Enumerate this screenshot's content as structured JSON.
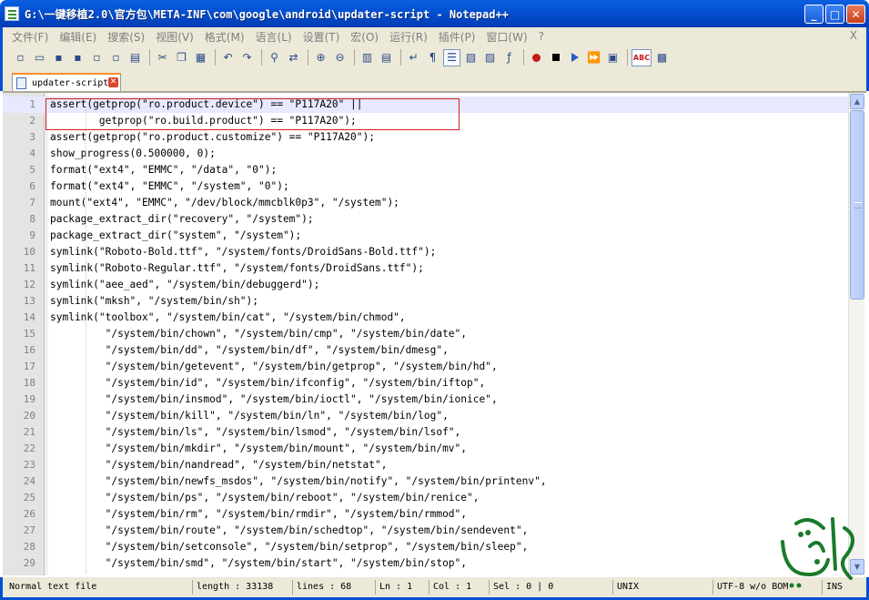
{
  "window": {
    "title": "G:\\一键移植2.0\\官方包\\META-INF\\com\\google\\android\\updater-script - Notepad++",
    "minimize_label": "_",
    "maximize_label": "□",
    "close_label": "✕"
  },
  "menu": {
    "items": [
      "文件(F)",
      "编辑(E)",
      "搜索(S)",
      "视图(V)",
      "格式(M)",
      "语言(L)",
      "设置(T)",
      "宏(O)",
      "运行(R)",
      "插件(P)",
      "窗口(W)",
      "?"
    ],
    "close_label": "X"
  },
  "toolbar": {
    "icons": [
      "new-file-icon",
      "open-file-icon",
      "save-icon",
      "save-all-icon",
      "close-icon",
      "close-all-icon",
      "print-icon",
      "cut-icon",
      "copy-icon",
      "paste-icon",
      "undo-icon",
      "redo-icon",
      "find-icon",
      "replace-icon",
      "zoom-in-icon",
      "zoom-out-icon",
      "sync-vertical-icon",
      "sync-horizontal-icon",
      "word-wrap-icon",
      "show-all-chars-icon",
      "indent-guide-icon",
      "user-define-icon",
      "doc-map-icon",
      "function-list-icon",
      "record-macro-icon",
      "stop-record-icon",
      "play-macro-icon",
      "run-macro-multiple-icon",
      "save-macro-icon",
      "spell-check-icon",
      "spell-check-options-icon"
    ],
    "spell_label": "ABC"
  },
  "tab": {
    "label": "updater-script",
    "close_label": "✕"
  },
  "editor": {
    "lines": [
      {
        "n": "1",
        "text": "assert(getprop(\"ro.product.device\") == \"P117A20\" ||"
      },
      {
        "n": "2",
        "text": "        getprop(\"ro.build.product\") == \"P117A20\");"
      },
      {
        "n": "3",
        "text": "assert(getprop(\"ro.product.customize\") == \"P117A20\");"
      },
      {
        "n": "4",
        "text": "show_progress(0.500000, 0);"
      },
      {
        "n": "5",
        "text": "format(\"ext4\", \"EMMC\", \"/data\", \"0\");"
      },
      {
        "n": "6",
        "text": "format(\"ext4\", \"EMMC\", \"/system\", \"0\");"
      },
      {
        "n": "7",
        "text": "mount(\"ext4\", \"EMMC\", \"/dev/block/mmcblk0p3\", \"/system\");"
      },
      {
        "n": "8",
        "text": "package_extract_dir(\"recovery\", \"/system\");"
      },
      {
        "n": "9",
        "text": "package_extract_dir(\"system\", \"/system\");"
      },
      {
        "n": "10",
        "text": "symlink(\"Roboto-Bold.ttf\", \"/system/fonts/DroidSans-Bold.ttf\");"
      },
      {
        "n": "11",
        "text": "symlink(\"Roboto-Regular.ttf\", \"/system/fonts/DroidSans.ttf\");"
      },
      {
        "n": "12",
        "text": "symlink(\"aee_aed\", \"/system/bin/debuggerd\");"
      },
      {
        "n": "13",
        "text": "symlink(\"mksh\", \"/system/bin/sh\");"
      },
      {
        "n": "14",
        "text": "symlink(\"toolbox\", \"/system/bin/cat\", \"/system/bin/chmod\","
      },
      {
        "n": "15",
        "text": "         \"/system/bin/chown\", \"/system/bin/cmp\", \"/system/bin/date\","
      },
      {
        "n": "16",
        "text": "         \"/system/bin/dd\", \"/system/bin/df\", \"/system/bin/dmesg\","
      },
      {
        "n": "17",
        "text": "         \"/system/bin/getevent\", \"/system/bin/getprop\", \"/system/bin/hd\","
      },
      {
        "n": "18",
        "text": "         \"/system/bin/id\", \"/system/bin/ifconfig\", \"/system/bin/iftop\","
      },
      {
        "n": "19",
        "text": "         \"/system/bin/insmod\", \"/system/bin/ioctl\", \"/system/bin/ionice\","
      },
      {
        "n": "20",
        "text": "         \"/system/bin/kill\", \"/system/bin/ln\", \"/system/bin/log\","
      },
      {
        "n": "21",
        "text": "         \"/system/bin/ls\", \"/system/bin/lsmod\", \"/system/bin/lsof\","
      },
      {
        "n": "22",
        "text": "         \"/system/bin/mkdir\", \"/system/bin/mount\", \"/system/bin/mv\","
      },
      {
        "n": "23",
        "text": "         \"/system/bin/nandread\", \"/system/bin/netstat\","
      },
      {
        "n": "24",
        "text": "         \"/system/bin/newfs_msdos\", \"/system/bin/notify\", \"/system/bin/printenv\","
      },
      {
        "n": "25",
        "text": "         \"/system/bin/ps\", \"/system/bin/reboot\", \"/system/bin/renice\","
      },
      {
        "n": "26",
        "text": "         \"/system/bin/rm\", \"/system/bin/rmdir\", \"/system/bin/rmmod\","
      },
      {
        "n": "27",
        "text": "         \"/system/bin/route\", \"/system/bin/schedtop\", \"/system/bin/sendevent\","
      },
      {
        "n": "28",
        "text": "         \"/system/bin/setconsole\", \"/system/bin/setprop\", \"/system/bin/sleep\","
      },
      {
        "n": "29",
        "text": "         \"/system/bin/smd\", \"/system/bin/start\", \"/system/bin/stop\","
      }
    ]
  },
  "statusbar": {
    "file_type": "Normal text file",
    "length": "length : 33138",
    "lines": "lines : 68",
    "ln": "Ln : 1",
    "col": "Col : 1",
    "sel": "Sel : 0 | 0",
    "eol": "UNIX",
    "encoding": "UTF-8 w/o BOM",
    "mode": "INS"
  },
  "colors": {
    "titlebar": "#0450d2",
    "chrome": "#ece9d8",
    "current_line": "#e8e8ff",
    "highlight_box": "#d02020",
    "watermark": "#1a7a2a"
  }
}
